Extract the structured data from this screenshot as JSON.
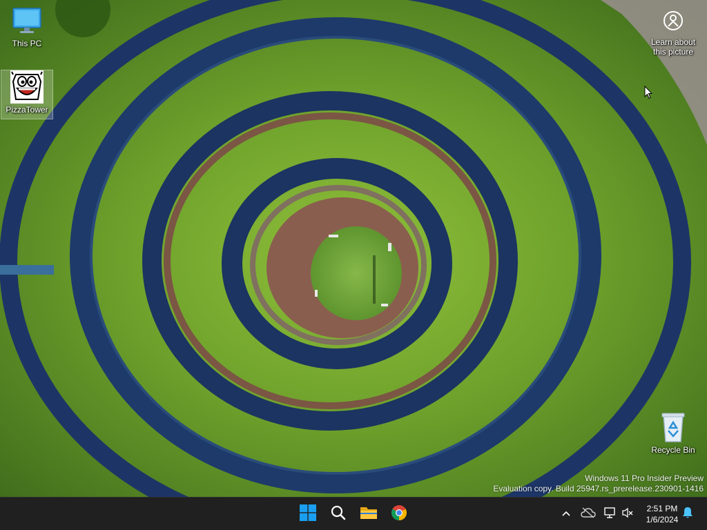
{
  "desktop": {
    "icons": [
      {
        "name": "This PC",
        "icon": "monitor-icon"
      },
      {
        "name": "PizzaTower",
        "icon": "pizzatower-app-icon"
      },
      {
        "name": "Recycle Bin",
        "icon": "recycle-bin-icon"
      }
    ],
    "spotlight": {
      "label": "Learn about this picture",
      "icon": "camera-info-icon"
    },
    "watermark": {
      "line1": "Windows 11 Pro Insider Preview",
      "line2": "Evaluation copy. Build 25947.rs_prerelease.230901-1416"
    },
    "wallpaper": {
      "subject": "concentric grass rings aerial view",
      "grass": "#5e8f2a",
      "channel": "#1f3a66",
      "path": "#8a5a44"
    }
  },
  "taskbar": {
    "background": "#202020",
    "pinned": [
      {
        "name": "Start",
        "icon": "windows-logo-icon"
      },
      {
        "name": "Search",
        "icon": "search-icon"
      },
      {
        "name": "File Explorer",
        "icon": "folder-icon"
      },
      {
        "name": "Google Chrome",
        "icon": "chrome-icon"
      }
    ],
    "tray": {
      "icons": [
        "chevron-up-icon",
        "onedrive-icon",
        "network-icon",
        "volume-muted-icon",
        "notification-bell-icon"
      ],
      "time": "2:51 PM",
      "date": "1/6/2024",
      "accent": "#4cc2ff"
    }
  }
}
